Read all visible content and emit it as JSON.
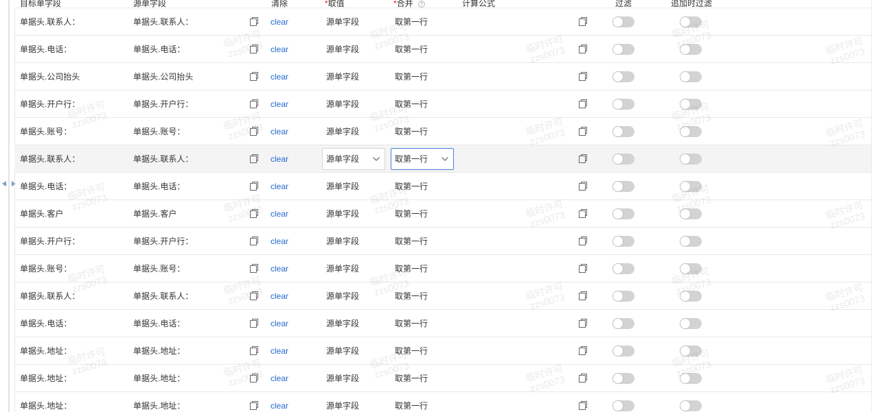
{
  "header": {
    "target": "目标单字段",
    "source": "源单字段",
    "clear": "清除",
    "required_mark": "*",
    "value": "取值",
    "merge": "合并",
    "formula": "计算公式",
    "filter": "过滤",
    "append_filter": "追加时过滤"
  },
  "labels": {
    "clear": "clear"
  },
  "rows": [
    {
      "target": "单据头.联系人：",
      "source": "单据头.联系人：",
      "value": "源单字段",
      "merge": "取第一行",
      "filter": false,
      "append_filter": false
    },
    {
      "target": "单据头.电话：",
      "source": "单据头.电话：",
      "value": "源单字段",
      "merge": "取第一行",
      "filter": false,
      "append_filter": false
    },
    {
      "target": "单据头.公司抬头",
      "source": "单据头.公司抬头",
      "value": "源单字段",
      "merge": "取第一行",
      "filter": false,
      "append_filter": false
    },
    {
      "target": "单据头.开户行：",
      "source": "单据头.开户行：",
      "value": "源单字段",
      "merge": "取第一行",
      "filter": false,
      "append_filter": false
    },
    {
      "target": "单据头.账号：",
      "source": "单据头.账号：",
      "value": "源单字段",
      "merge": "取第一行",
      "filter": false,
      "append_filter": false
    },
    {
      "target": "单据头.联系人：",
      "source": "单据头.联系人：",
      "value": "源单字段",
      "merge": "取第一行",
      "filter": false,
      "append_filter": false,
      "selected": true,
      "merge_focused": true
    },
    {
      "target": "单据头.电话：",
      "source": "单据头.电话：",
      "value": "源单字段",
      "merge": "取第一行",
      "filter": false,
      "append_filter": false
    },
    {
      "target": "单据头.客户",
      "source": "单据头.客户",
      "value": "源单字段",
      "merge": "取第一行",
      "filter": false,
      "append_filter": false
    },
    {
      "target": "单据头.开户行：",
      "source": "单据头.开户行：",
      "value": "源单字段",
      "merge": "取第一行",
      "filter": false,
      "append_filter": false
    },
    {
      "target": "单据头.账号：",
      "source": "单据头.账号：",
      "value": "源单字段",
      "merge": "取第一行",
      "filter": false,
      "append_filter": false
    },
    {
      "target": "单据头.联系人：",
      "source": "单据头.联系人：",
      "value": "源单字段",
      "merge": "取第一行",
      "filter": false,
      "append_filter": false
    },
    {
      "target": "单据头.电话：",
      "source": "单据头.电话：",
      "value": "源单字段",
      "merge": "取第一行",
      "filter": false,
      "append_filter": false
    },
    {
      "target": "单据头.地址：",
      "source": "单据头.地址：",
      "value": "源单字段",
      "merge": "取第一行",
      "filter": false,
      "append_filter": false
    },
    {
      "target": "单据头.地址：",
      "source": "单据头.地址：",
      "value": "源单字段",
      "merge": "取第一行",
      "filter": false,
      "append_filter": false
    },
    {
      "target": "单据头.地址：",
      "source": "单据头.地址：",
      "value": "源单字段",
      "merge": "取第一行",
      "filter": false,
      "append_filter": false
    }
  ],
  "watermark": {
    "line1": "临时许可",
    "line2": "zzs0073"
  },
  "icons": {
    "copy": "copy-icon",
    "help": "question-circle-icon",
    "dropdown": "chevron-down-icon",
    "collapse": "caret-left-icon",
    "expand": "caret-right-icon"
  },
  "colors": {
    "link": "#2369d0",
    "required": "#e0201e",
    "focus_border": "#4a7fd9",
    "selected_row_bg": "#f4f4f4",
    "caret": "#7d9ccb"
  }
}
